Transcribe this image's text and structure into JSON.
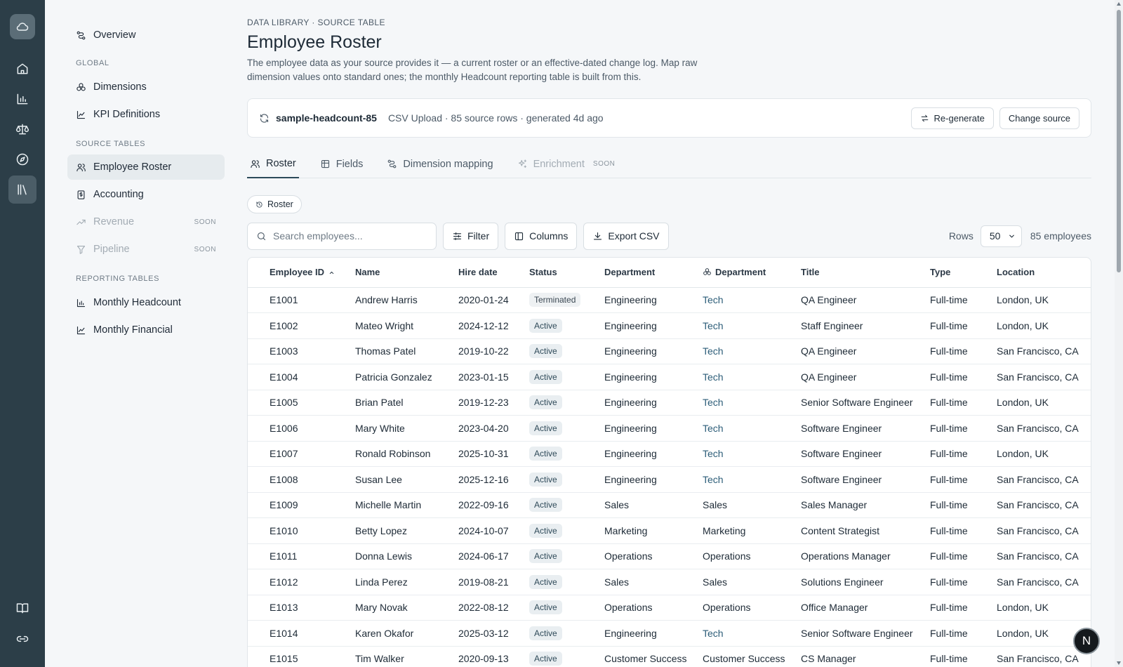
{
  "sidebar": {
    "overview": "Overview",
    "sections": {
      "global": "GLOBAL",
      "source_tables": "SOURCE TABLES",
      "reporting_tables": "REPORTING TABLES"
    },
    "items": [
      {
        "label": "Dimensions"
      },
      {
        "label": "KPI Definitions"
      },
      {
        "label": "Employee Roster"
      },
      {
        "label": "Accounting"
      },
      {
        "label": "Revenue",
        "badge": "SOON"
      },
      {
        "label": "Pipeline",
        "badge": "SOON"
      },
      {
        "label": "Monthly Headcount"
      },
      {
        "label": "Monthly Financial"
      }
    ]
  },
  "header": {
    "breadcrumb": "DATA LIBRARY · SOURCE TABLE",
    "title": "Employee Roster",
    "description": "The employee data as your source provides it — a current roster or an effective-dated change log. Map raw dimension values onto standard ones; the monthly Headcount reporting table is built from this."
  },
  "source": {
    "name": "sample-headcount-85",
    "meta": "CSV Upload · 85 source rows · generated 4d ago",
    "regenerate_label": "Re-generate",
    "change_label": "Change source"
  },
  "tabs": [
    {
      "label": "Roster"
    },
    {
      "label": "Fields"
    },
    {
      "label": "Dimension mapping"
    },
    {
      "label": "Enrichment",
      "badge": "SOON"
    }
  ],
  "view_pill": "Roster",
  "toolbar": {
    "search_placeholder": "Search employees...",
    "filter_label": "Filter",
    "columns_label": "Columns",
    "export_label": "Export CSV",
    "rows_label": "Rows",
    "rows_value": "50",
    "count_label": "85 employees"
  },
  "table": {
    "headers": [
      "Employee ID",
      "Name",
      "Hire date",
      "Status",
      "Department",
      "Department",
      "Title",
      "Type",
      "Location"
    ],
    "rows": [
      [
        "E1001",
        "Andrew Harris",
        "2020-01-24",
        "Terminated",
        "Engineering",
        "Tech",
        "QA Engineer",
        "Full-time",
        "London, UK"
      ],
      [
        "E1002",
        "Mateo Wright",
        "2024-12-12",
        "Active",
        "Engineering",
        "Tech",
        "Staff Engineer",
        "Full-time",
        "London, UK"
      ],
      [
        "E1003",
        "Thomas Patel",
        "2019-10-22",
        "Active",
        "Engineering",
        "Tech",
        "QA Engineer",
        "Full-time",
        "San Francisco, CA"
      ],
      [
        "E1004",
        "Patricia Gonzalez",
        "2023-01-15",
        "Active",
        "Engineering",
        "Tech",
        "QA Engineer",
        "Full-time",
        "San Francisco, CA"
      ],
      [
        "E1005",
        "Brian Patel",
        "2019-12-23",
        "Active",
        "Engineering",
        "Tech",
        "Senior Software Engineer",
        "Full-time",
        "London, UK"
      ],
      [
        "E1006",
        "Mary White",
        "2023-04-20",
        "Active",
        "Engineering",
        "Tech",
        "Software Engineer",
        "Full-time",
        "San Francisco, CA"
      ],
      [
        "E1007",
        "Ronald Robinson",
        "2025-10-31",
        "Active",
        "Engineering",
        "Tech",
        "Software Engineer",
        "Full-time",
        "London, UK"
      ],
      [
        "E1008",
        "Susan Lee",
        "2025-12-16",
        "Active",
        "Engineering",
        "Tech",
        "Software Engineer",
        "Full-time",
        "San Francisco, CA"
      ],
      [
        "E1009",
        "Michelle Martin",
        "2022-09-16",
        "Active",
        "Sales",
        "Sales",
        "Sales Manager",
        "Full-time",
        "San Francisco, CA"
      ],
      [
        "E1010",
        "Betty Lopez",
        "2024-10-07",
        "Active",
        "Marketing",
        "Marketing",
        "Content Strategist",
        "Full-time",
        "San Francisco, CA"
      ],
      [
        "E1011",
        "Donna Lewis",
        "2024-06-17",
        "Active",
        "Operations",
        "Operations",
        "Operations Manager",
        "Full-time",
        "San Francisco, CA"
      ],
      [
        "E1012",
        "Linda Perez",
        "2019-08-21",
        "Active",
        "Sales",
        "Sales",
        "Solutions Engineer",
        "Full-time",
        "San Francisco, CA"
      ],
      [
        "E1013",
        "Mary Novak",
        "2022-08-12",
        "Active",
        "Operations",
        "Operations",
        "Office Manager",
        "Full-time",
        "London, UK"
      ],
      [
        "E1014",
        "Karen Okafor",
        "2025-03-12",
        "Active",
        "Engineering",
        "Tech",
        "Senior Software Engineer",
        "Full-time",
        "London, UK"
      ],
      [
        "E1015",
        "Tim Walker",
        "2020-09-13",
        "Active",
        "Customer Success",
        "Customer Success",
        "CS Manager",
        "Full-time",
        "San Francisco, CA"
      ]
    ]
  },
  "user": {
    "initial": "N"
  },
  "colors": {
    "rail": "#2c3e48",
    "accent": "#2c5d78"
  }
}
